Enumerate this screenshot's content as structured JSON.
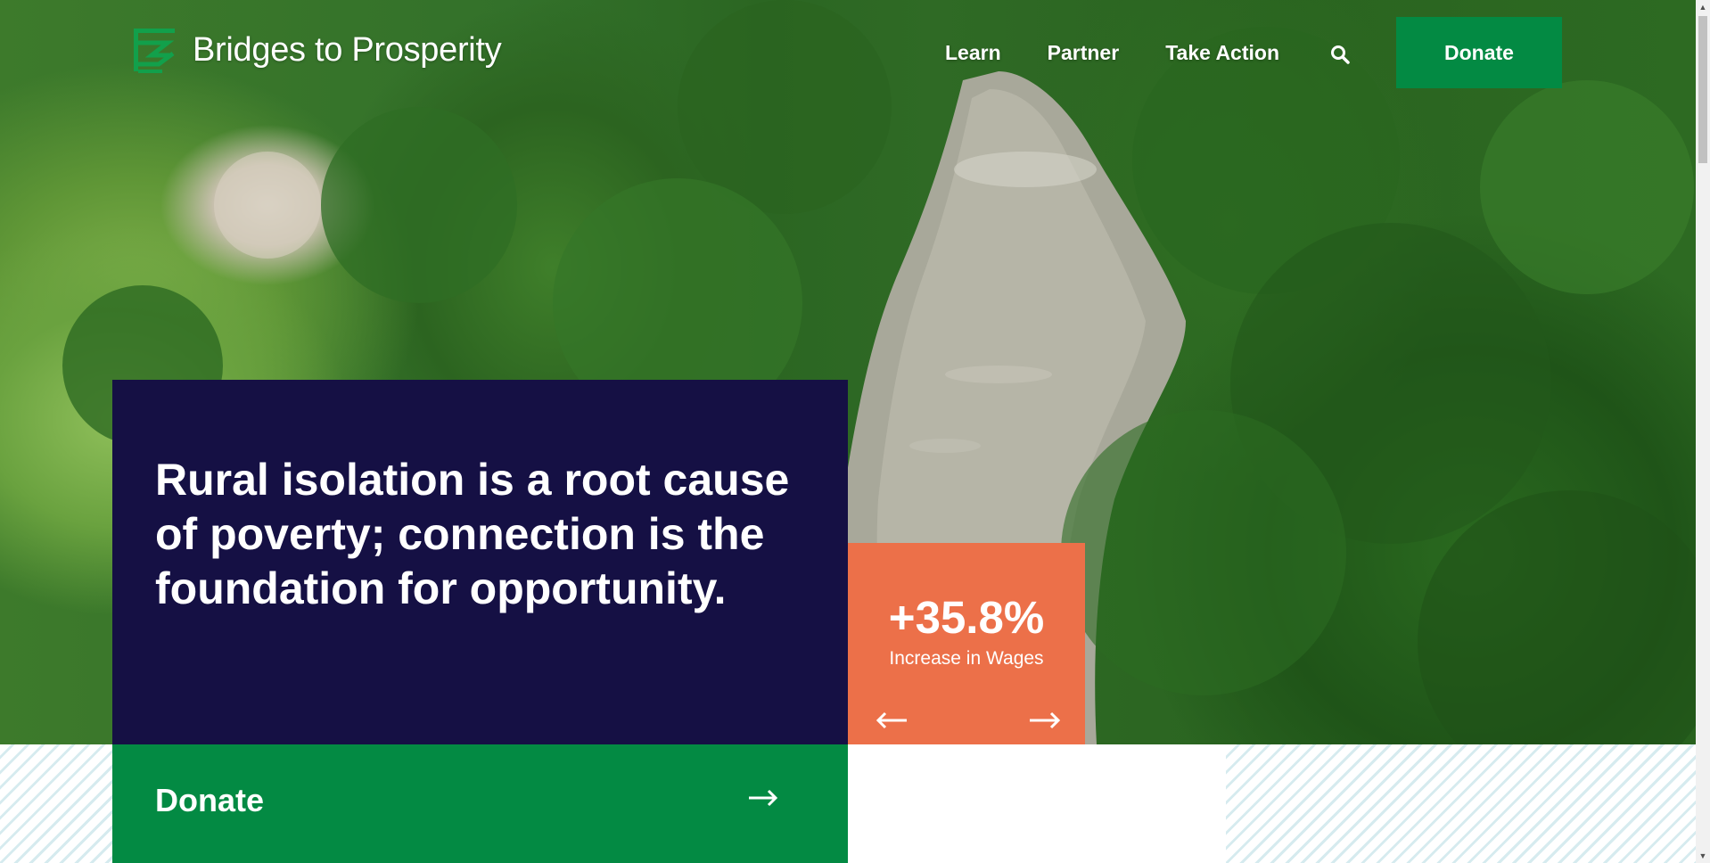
{
  "header": {
    "logo_text": "Bridges to Prosperity",
    "nav": [
      "Learn",
      "Partner",
      "Take Action"
    ],
    "search_icon": "search-icon",
    "donate_label": "Donate"
  },
  "hero": {
    "tagline": "Rural isolation is a root cause of poverty; connection is the foundation for opportunity.",
    "stat": {
      "value": "+35.8%",
      "label": "Increase in Wages",
      "prev_icon": "arrow-left-icon",
      "next_icon": "arrow-right-icon"
    }
  },
  "cta": {
    "label": "Donate",
    "arrow_icon": "arrow-right-icon"
  },
  "colors": {
    "brand_green": "#038a43",
    "navy": "#151044",
    "orange": "#ec7049"
  }
}
